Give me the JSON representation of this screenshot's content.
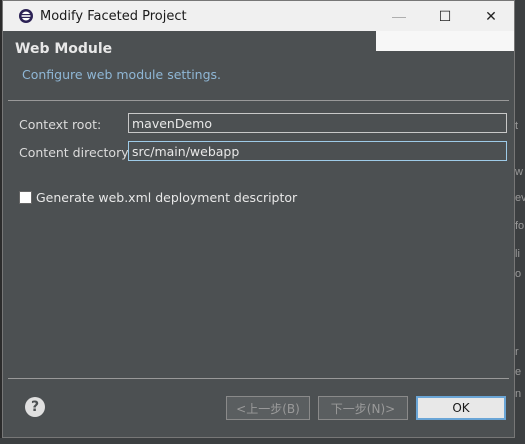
{
  "window": {
    "title": "Modify Faceted Project",
    "minimize_label": "—",
    "maximize_label": "☐",
    "close_label": "✕"
  },
  "page": {
    "title": "Web Module",
    "description": "Configure web module settings."
  },
  "form": {
    "context_root_label": "Context root:",
    "context_root_value": "mavenDemo",
    "content_directory_label": "Content directory:",
    "content_directory_value": "src/main/webapp",
    "generate_webxml_label": "Generate web.xml deployment descriptor",
    "generate_webxml_checked": false
  },
  "buttons": {
    "help": "?",
    "back": "<上一步(B)",
    "next": "下一步(N)>",
    "ok": "OK"
  },
  "background_text": [
    "t",
    "w",
    "ev",
    "fo",
    "li",
    "o",
    "r",
    "e",
    "n"
  ],
  "colors": {
    "dialog_bg": "#4c5052",
    "description": "#8fb7d6",
    "ok_border": "#6aa5d6"
  }
}
